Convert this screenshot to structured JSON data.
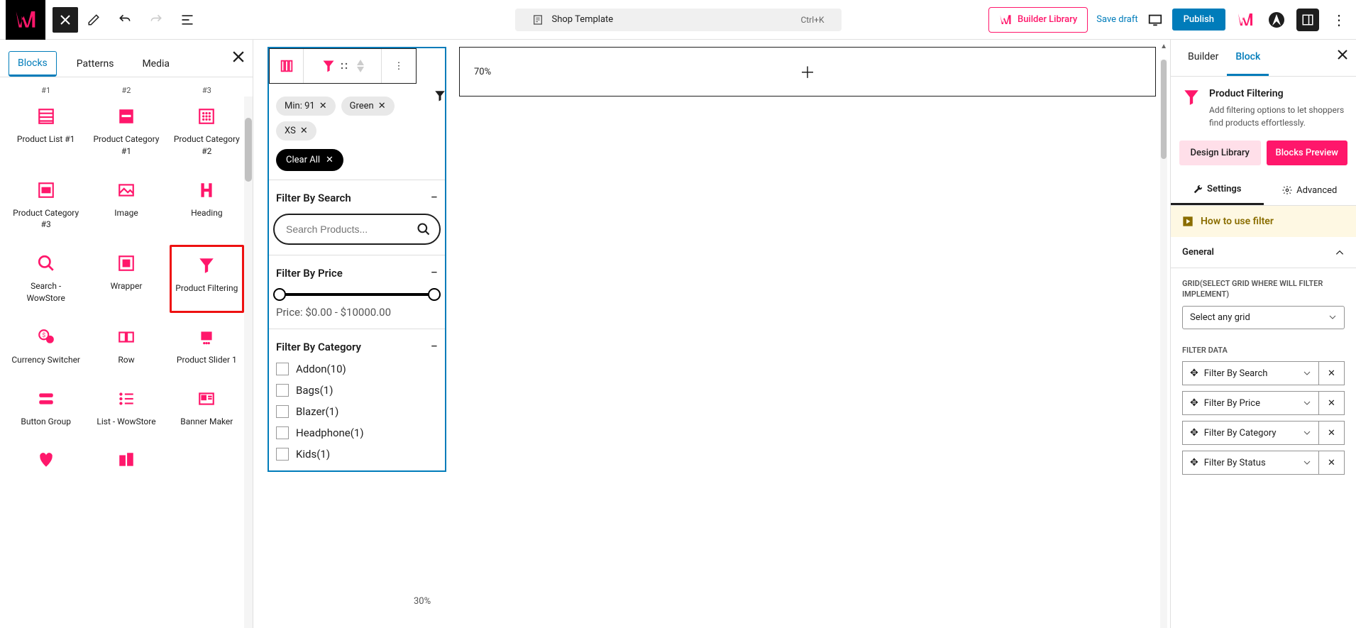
{
  "top": {
    "title": "Shop Template",
    "shortcut": "Ctrl+K",
    "builder_library": "Builder Library",
    "save_draft": "Save draft",
    "publish": "Publish"
  },
  "left": {
    "tabs": {
      "blocks": "Blocks",
      "patterns": "Patterns",
      "media": "Media"
    },
    "row_top": {
      "c1": "#1",
      "c2": "#2",
      "c3": "#3"
    },
    "blocks": [
      {
        "label": "Product List #1"
      },
      {
        "label": "Product Category #1"
      },
      {
        "label": "Product Category #2"
      },
      {
        "label": "Product Category #3"
      },
      {
        "label": "Image"
      },
      {
        "label": "Heading"
      },
      {
        "label": "Search - WowStore"
      },
      {
        "label": "Wrapper"
      },
      {
        "label": "Product Filtering"
      },
      {
        "label": "Currency Switcher"
      },
      {
        "label": "Row"
      },
      {
        "label": "Product Slider 1"
      },
      {
        "label": "Button Group"
      },
      {
        "label": "List - WowStore"
      },
      {
        "label": "Banner Maker"
      }
    ]
  },
  "canvas": {
    "chips": [
      "Min: 91",
      "Green",
      "XS"
    ],
    "clear_all": "Clear All",
    "filter_search_title": "Filter By Search",
    "search_placeholder": "Search Products...",
    "filter_price_title": "Filter By Price",
    "price_text": "Price: $0.00 - $10000.00",
    "filter_category_title": "Filter By Category",
    "categories": [
      "Addon(10)",
      "Bags(1)",
      "Blazer(1)",
      "Headphone(1)",
      "Kids(1)"
    ],
    "offer_pct": "70%",
    "zoom_pct": "30%"
  },
  "right": {
    "tabs": {
      "builder": "Builder",
      "block": "Block"
    },
    "block_title": "Product Filtering",
    "block_desc": "Add filtering options to let shoppers find products effortlessly.",
    "design_library": "Design Library",
    "blocks_preview": "Blocks Preview",
    "sub_settings": "Settings",
    "sub_advanced": "Advanced",
    "howto": "How to use filter",
    "section_general": "General",
    "grid_label": "GRID(SELECT GRID WHERE WILL FILTER IMPLEMENT)",
    "grid_placeholder": "Select any grid",
    "filter_data_label": "FILTER DATA",
    "filter_data": [
      "Filter By Search",
      "Filter By Price",
      "Filter By Category",
      "Filter By Status"
    ]
  }
}
